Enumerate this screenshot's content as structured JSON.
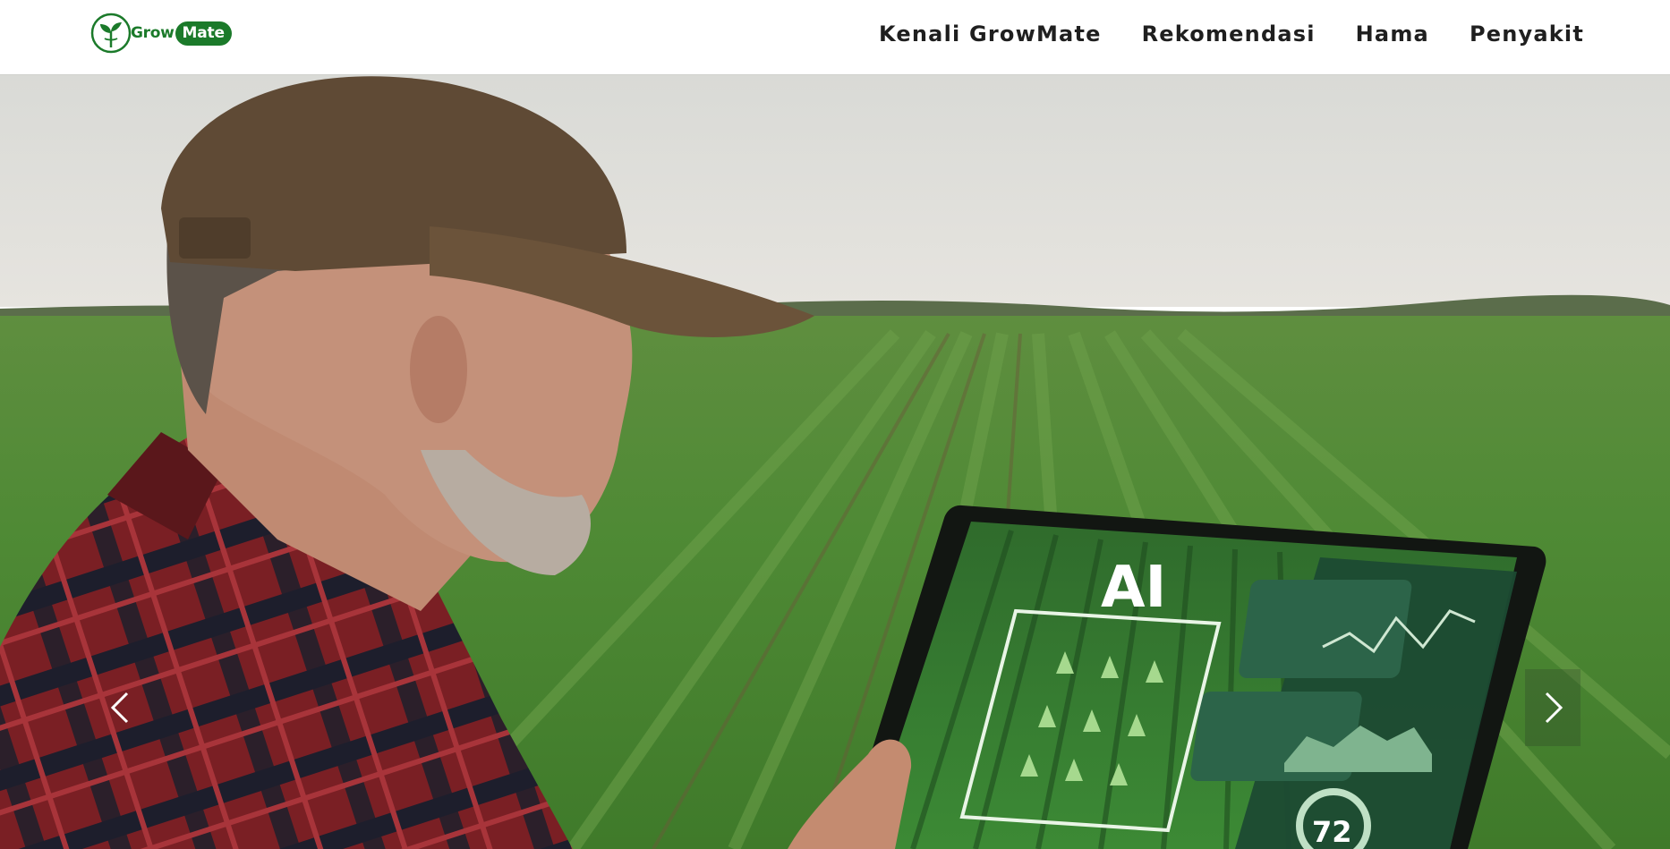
{
  "header": {
    "logo": {
      "grow": "Grow",
      "mate": "Mate"
    },
    "nav": [
      {
        "label": "Kenali GrowMate"
      },
      {
        "label": "Rekomendasi"
      },
      {
        "label": "Hama"
      },
      {
        "label": "Penyakit"
      }
    ]
  },
  "hero": {
    "tablet": {
      "overlay_text": "AI",
      "gauge_text": "72"
    },
    "prev_icon": "chevron-left-icon",
    "next_icon": "chevron-right-icon"
  },
  "colors": {
    "brand": "#1b7a2a",
    "nav_text": "#1f1f1f"
  }
}
